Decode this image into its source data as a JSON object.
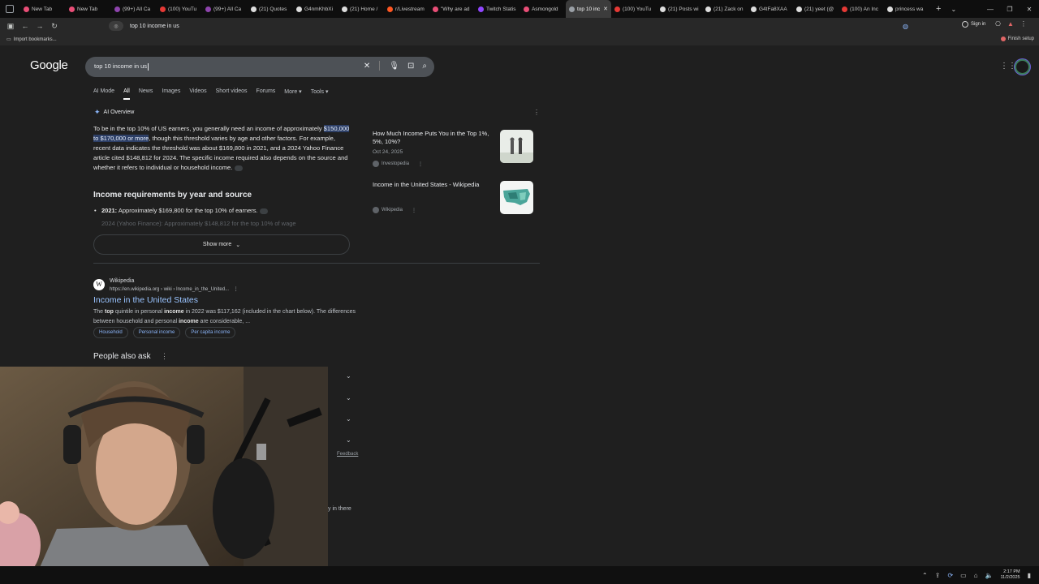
{
  "tabs": [
    {
      "label": "New Tab",
      "color": "#e94e77"
    },
    {
      "label": "New Tab",
      "color": "#e94e77"
    },
    {
      "label": "(99+) All Ca",
      "color": "#8e44ad"
    },
    {
      "label": "(100) YouTu",
      "color": "#e53935"
    },
    {
      "label": "(99+) All Ca",
      "color": "#8e44ad"
    },
    {
      "label": "(21) Quotes",
      "color": "#dddddd"
    },
    {
      "label": "G4nmKhbXi",
      "color": "#dddddd"
    },
    {
      "label": "(21) Home /",
      "color": "#dddddd"
    },
    {
      "label": "r/Livestream",
      "color": "#ff5722"
    },
    {
      "label": "\"Why are ad",
      "color": "#e94e77"
    },
    {
      "label": "Twitch Statis",
      "color": "#9146ff"
    },
    {
      "label": "Asmongold",
      "color": "#e94e77"
    },
    {
      "label": "top 10 inc",
      "color": "#9aa0a6",
      "active": true
    },
    {
      "label": "(100) YouTu",
      "color": "#e53935"
    },
    {
      "label": "(21) Posts wi",
      "color": "#dddddd"
    },
    {
      "label": "(21) Zack on",
      "color": "#dddddd"
    },
    {
      "label": "G4tFa8XAA",
      "color": "#dddddd"
    },
    {
      "label": "(21) yeet (@",
      "color": "#dddddd"
    },
    {
      "label": "(100) An Inc",
      "color": "#e53935"
    },
    {
      "label": "princess wa",
      "color": "#dddddd"
    }
  ],
  "toolbar": {
    "address": "top 10 income in us",
    "sign_in": "Sign in"
  },
  "bookmarks": {
    "import": "Import bookmarks...",
    "finish_setup": "Finish setup"
  },
  "google": {
    "logo": "Google",
    "query": "top 10 income in us"
  },
  "search_tabs": [
    "AI Mode",
    "All",
    "News",
    "Images",
    "Videos",
    "Short videos",
    "Forums",
    "More ▾",
    "Tools ▾"
  ],
  "ai_overview": {
    "label": "AI Overview",
    "para_pre": "To be in the top 10% of US earners, you generally need an income of approximately ",
    "para_hl": "$150,000 to $170,000 or more",
    "para_post": ", though this threshold varies by age and other factors. For example, recent data indicates the threshold was about $169,800 in 2021, and a 2024 Yahoo Finance article cited $148,812 for 2024. The specific income required also depends on the source and whether it refers to individual or household income.",
    "heading": "Income requirements by year and source",
    "item1_year": "2021:",
    "item1_text": " Approximately $169,800 for the top 10% of earners.",
    "item2_text": "2024 (Yahoo Finance): Approximately $148,812 for the top 10% of wage",
    "show_more": "Show more",
    "sources": [
      {
        "title": "How Much Income Puts You in the Top 1%, 5%, 10%?",
        "date": "Oct 24, 2025",
        "site": "Investopedia"
      },
      {
        "title": "Income in the United States - Wikipedia",
        "site": "Wikipedia"
      }
    ]
  },
  "result": {
    "site_name": "Wikipedia",
    "url": "https://en.wikipedia.org › wiki › Income_in_the_United...",
    "title": "Income in the United States",
    "snippet_1": "The ",
    "snippet_b1": "top",
    "snippet_2": " quintile in personal ",
    "snippet_b2": "income",
    "snippet_3": " in 2022 was $117,162 (included in the chart below). The differences between household and personal ",
    "snippet_b3": "income",
    "snippet_4": " are considerable, ...",
    "chips": [
      "Household",
      "Personal income",
      "Per capita income"
    ]
  },
  "paa": {
    "title": "People also ask",
    "feedback": "Feedback",
    "fragment": "y in there"
  },
  "clock": {
    "time": "2:17 PM",
    "date": "11/2/2025"
  }
}
